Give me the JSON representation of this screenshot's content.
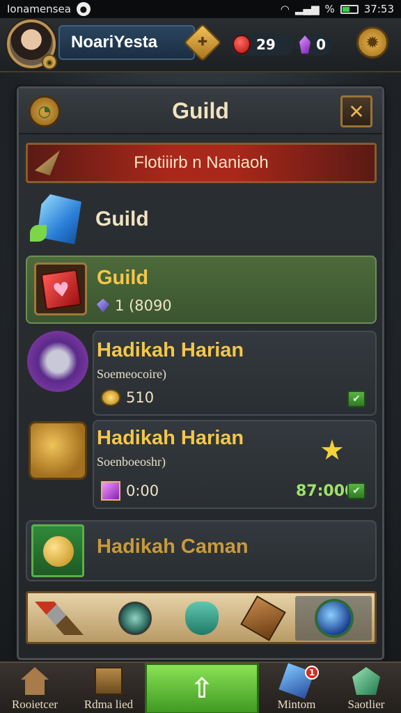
{
  "status_bar": {
    "carrier": "Ionamensea",
    "battery_pct": "%",
    "time": "37:53"
  },
  "player": {
    "name": "NoariYesta",
    "currency_red": "29",
    "currency_purple": "0"
  },
  "panel": {
    "title": "Guild",
    "banner": "Flotiiirb  n  Naniaoh",
    "section_label": "Guild"
  },
  "cards": [
    {
      "title": "Guild",
      "value": "1 (8090",
      "highlighted": true,
      "icon": "heart-box-icon"
    },
    {
      "title": "Hadikah Harian",
      "subtitle": "Soemeocoire)",
      "value": "510",
      "icon": "orb-icon"
    },
    {
      "title": "Hadikah Harian",
      "subtitle": "Soenboeoshr)",
      "value": "0:00",
      "price": "87:000",
      "icon": "gear-machine-icon"
    },
    {
      "title": "Hadikah Caman",
      "icon": "gold-orb-icon"
    }
  ],
  "shelf_items": [
    "sword-icon",
    "orb-slot-icon",
    "pouch-icon",
    "rune-icon",
    "blue-orb-icon"
  ],
  "bottom_nav": [
    {
      "label": "Rooietcer",
      "icon": "house-icon"
    },
    {
      "label": "Rdma lied",
      "icon": "mirror-icon"
    },
    {
      "label": "",
      "icon": "home-arrow-icon"
    },
    {
      "label": "Mintom",
      "icon": "crystal-icon",
      "badge": "1"
    },
    {
      "label": "Saotlier",
      "icon": "emerald-icon"
    }
  ],
  "colors": {
    "accent_gold": "#f5c64a",
    "green_card": "#4d6a3b",
    "nav_center": "#6cc63e",
    "banner_red": "#a9271b"
  }
}
